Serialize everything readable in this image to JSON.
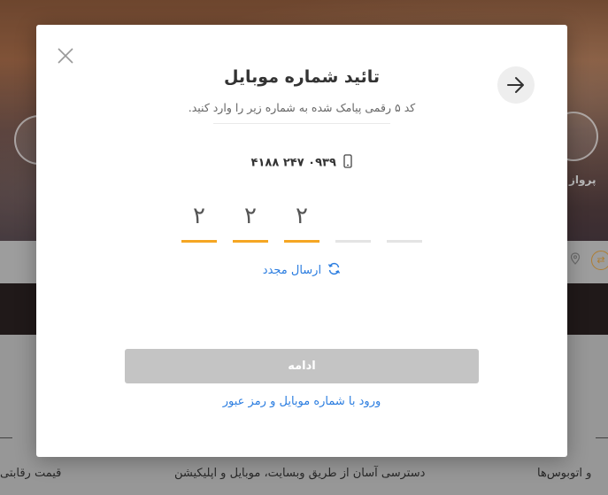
{
  "modal": {
    "title": "تائید شماره موبایل",
    "subtitle": "کد ۵ رقمی پیامک شده به شماره زیر را وارد کنید.",
    "phone_number": "۰۹۳۹ ۲۴۷ ۴۱۸۸",
    "code_digits": [
      "۲",
      "۲",
      "۲",
      "",
      ""
    ],
    "resend_label": "ارسال مجدد",
    "continue_label": "ادامه",
    "alt_login_label": "ورود با شماره موبایل و رمز عبور",
    "accent_color": "#f5a623",
    "link_color": "#2b7de0"
  },
  "background": {
    "service_label_right": "پرواز",
    "footer_left": "قیمت رقابتی",
    "footer_center": "دسترسی آسان از طریق وبسایت، موبایل و اپلیکیشن",
    "footer_right": "و اتوبوس‌ها"
  }
}
